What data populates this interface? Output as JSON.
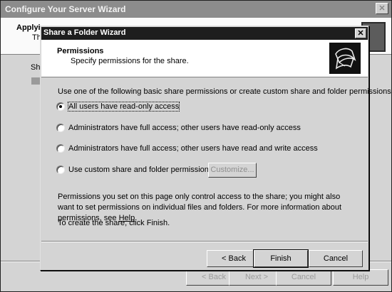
{
  "background_wizard": {
    "title": "Configure Your Server Wizard",
    "close_label": "✕",
    "header_title": "Applyi",
    "header_sub": "Th",
    "status_label": "Sh",
    "buttons": {
      "back": "< Back",
      "next": "Next >",
      "cancel": "Cancel",
      "help": "Help"
    }
  },
  "dialog": {
    "title": "Share a Folder Wizard",
    "close_label": "✕",
    "header_title": "Permissions",
    "header_subtitle": "Specify permissions for the share.",
    "header_icon": "shared-folder-icon",
    "intro": "Use one of the following basic share permissions or create custom share and folder permissions.",
    "options": [
      {
        "label": "All users have read-only access",
        "checked": true
      },
      {
        "label": "Administrators have full access; other users have read-only access",
        "checked": false
      },
      {
        "label": "Administrators have full access; other users have read and write access",
        "checked": false
      },
      {
        "label": "Use custom share and folder permissions",
        "checked": false
      }
    ],
    "customize_label": "Customize...",
    "info_text": "Permissions you set on this page only control access to the share; you might also want to set permissions on individual files and folders. For more information about permissions, see ",
    "help_link": "Help",
    "info_end": ".",
    "finish_note": "To create the share, click Finish.",
    "buttons": {
      "back": "< Back",
      "finish": "Finish",
      "cancel": "Cancel"
    }
  }
}
